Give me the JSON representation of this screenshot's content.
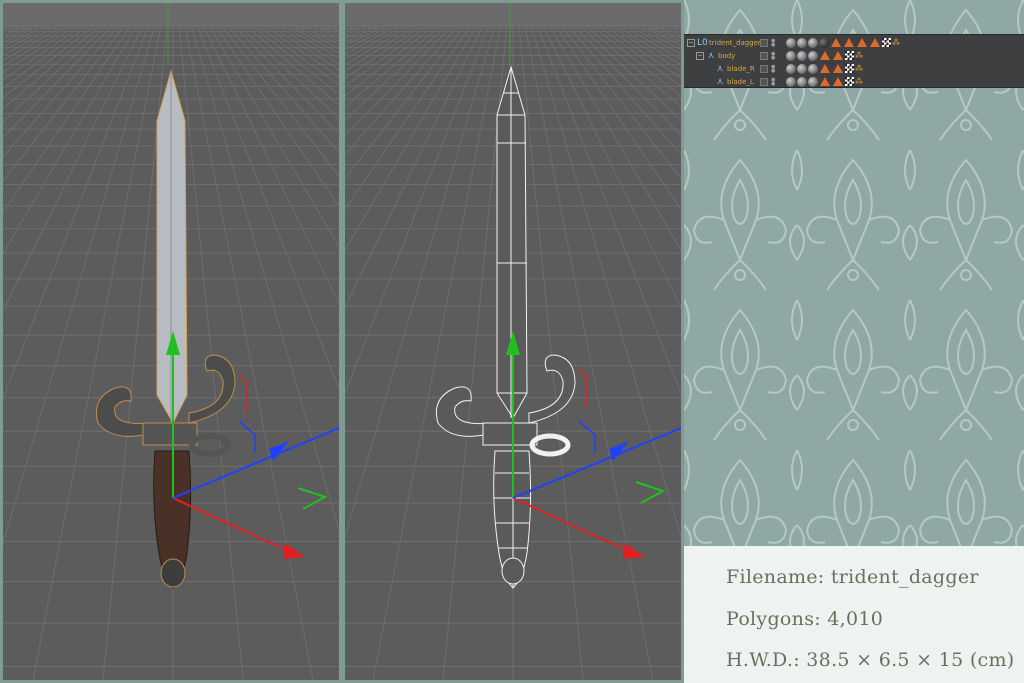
{
  "object_manager": {
    "rows": [
      {
        "name": "trident_dagger",
        "indent": 0,
        "expand": "−",
        "icon": "L0"
      },
      {
        "name": "body",
        "indent": 1,
        "expand": "−",
        "icon": "⋏"
      },
      {
        "name": "blade_R",
        "indent": 2,
        "expand": "",
        "icon": "⋏"
      },
      {
        "name": "blade_L",
        "indent": 2,
        "expand": "",
        "icon": "⋏"
      }
    ]
  },
  "info": {
    "filename": "Filename: trident_dagger",
    "polygons": "Polygons: 4,010",
    "dimensions": "H.W.D.: 38.5 × 6.5 × 15 (cm)"
  },
  "colors": {
    "viewport_bg": "#5c5c5c",
    "grid_line": "#6e6e6e",
    "axis_x": "#e02020",
    "axis_y": "#20c020",
    "axis_z": "#2040ff",
    "wallpaper": "#8fa8a6",
    "info_bg": "#eef3f1",
    "info_text": "#6e6e5e"
  },
  "icons": [
    "expand-collapse-icon",
    "null-object-icon",
    "visibility-toggle-icon",
    "material-tag-icon",
    "phong-tag-icon",
    "checker-tag-icon"
  ]
}
